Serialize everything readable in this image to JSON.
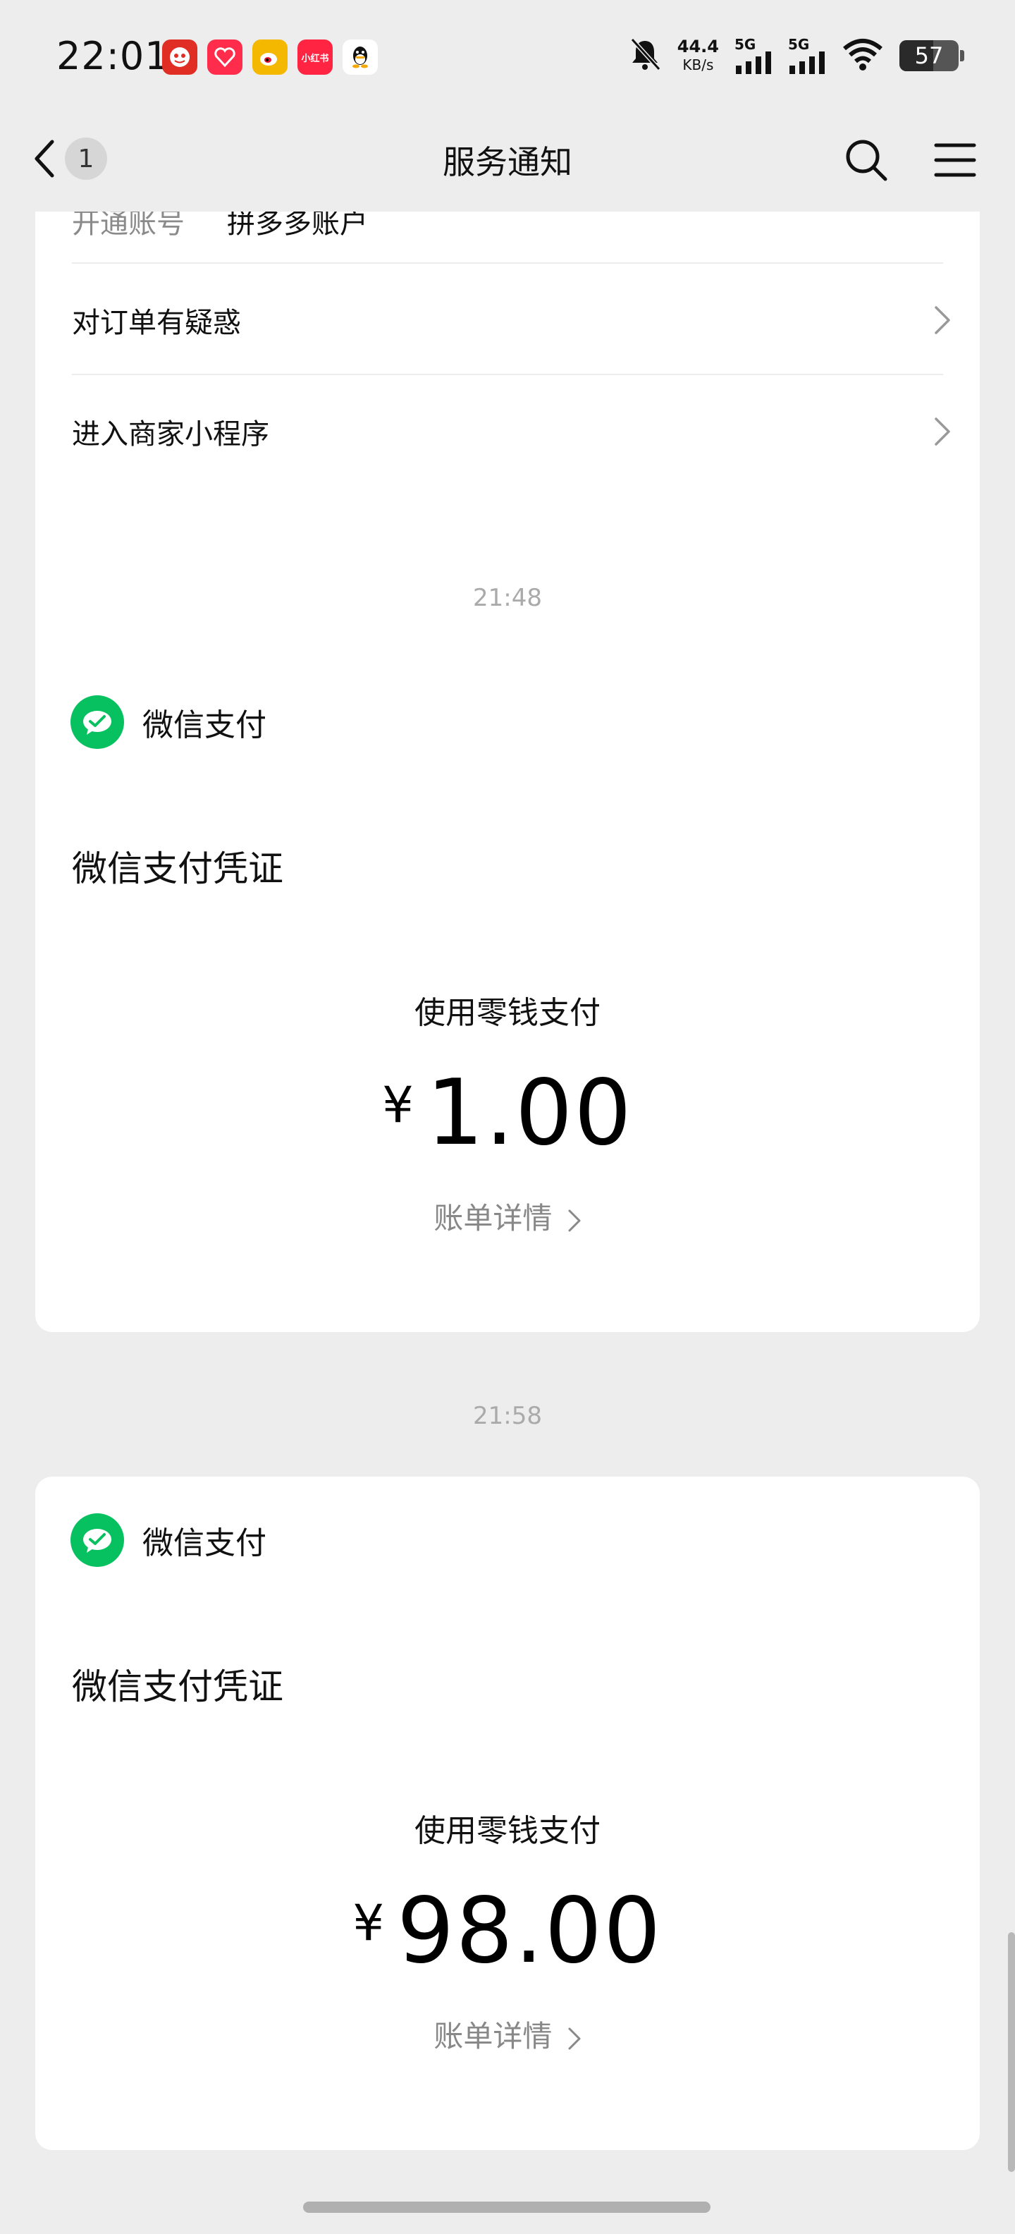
{
  "status_bar": {
    "time": "22:01",
    "apps": [
      {
        "icon": "pinduoduo-icon",
        "color": "#e02e24",
        "label": ""
      },
      {
        "icon": "taobao-heart-icon",
        "color": "#ff2d4b",
        "label": ""
      },
      {
        "icon": "weibo-icon",
        "color": "#f5b800",
        "label": ""
      },
      {
        "icon": "xiaohongshu-icon",
        "color": "#ff2442",
        "label": "小红书"
      },
      {
        "icon": "qq-icon",
        "color": "#ffffff",
        "label": ""
      }
    ],
    "net_speed_value": "44.4",
    "net_speed_unit": "KB/s",
    "sim1_label": "5G",
    "sim2_label": "5G",
    "battery_level": "57",
    "battery_fraction": 0.57
  },
  "nav": {
    "back_badge": "1",
    "title": "服务通知"
  },
  "top_card": {
    "partial_key": "开通账号",
    "partial_value": "拼多多账户",
    "links": [
      "对订单有疑惑",
      "进入商家小程序"
    ]
  },
  "messages": [
    {
      "time": "21:48",
      "sender": "微信支付",
      "voucher_title": "微信支付凭证",
      "method": "使用零钱支付",
      "currency": "¥",
      "amount": "1.00",
      "detail_link": "账单详情"
    },
    {
      "time": "21:58",
      "sender": "微信支付",
      "voucher_title": "微信支付凭证",
      "method": "使用零钱支付",
      "currency": "¥",
      "amount": "98.00",
      "detail_link": "账单详情"
    }
  ],
  "colors": {
    "background": "#ededed",
    "card": "#ffffff",
    "wechat_green": "#07c160",
    "muted_text": "#888888"
  }
}
